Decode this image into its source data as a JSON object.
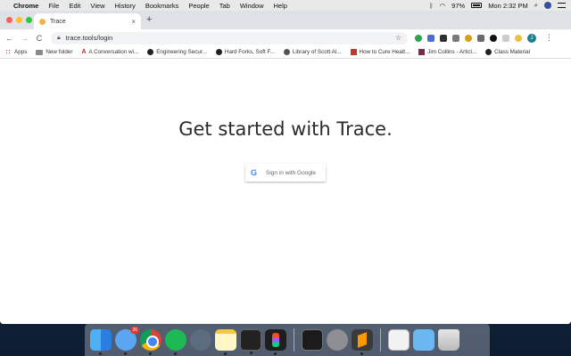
{
  "menubar": {
    "app": "Chrome",
    "menus": [
      "File",
      "Edit",
      "View",
      "History",
      "Bookmarks",
      "People",
      "Tab",
      "Window",
      "Help"
    ],
    "battery": "97%",
    "clock": "Mon 2:32 PM"
  },
  "tab": {
    "title": "Trace",
    "close": "×",
    "new_tab": "+"
  },
  "toolbar": {
    "back": "←",
    "forward": "→",
    "reload": "C",
    "url": "trace.tools/login",
    "star": "☆",
    "profile_initial": "J",
    "menu": "⋮"
  },
  "bookmarks": [
    {
      "label": "Apps",
      "icon": "apps-icon"
    },
    {
      "label": "New folder",
      "icon": "folder-icon"
    },
    {
      "label": "A Conversation wi...",
      "icon": "bookmark-a-icon"
    },
    {
      "label": "Engineering Secur...",
      "icon": "globe-icon"
    },
    {
      "label": "Hard Forks, Soft F...",
      "icon": "globe-icon"
    },
    {
      "label": "Library of Scott Al...",
      "icon": "wordpress-icon"
    },
    {
      "label": "How to Cure Healt...",
      "icon": "bookmark-red-icon"
    },
    {
      "label": "Jim Collins - Articl...",
      "icon": "bookmark-jc-icon"
    },
    {
      "label": "Class Material",
      "icon": "globe-icon"
    }
  ],
  "page": {
    "headline": "Get started with Trace.",
    "google_button": "Sign in with Google",
    "google_logo": "G"
  },
  "dock": {
    "messages_badge": "26"
  }
}
